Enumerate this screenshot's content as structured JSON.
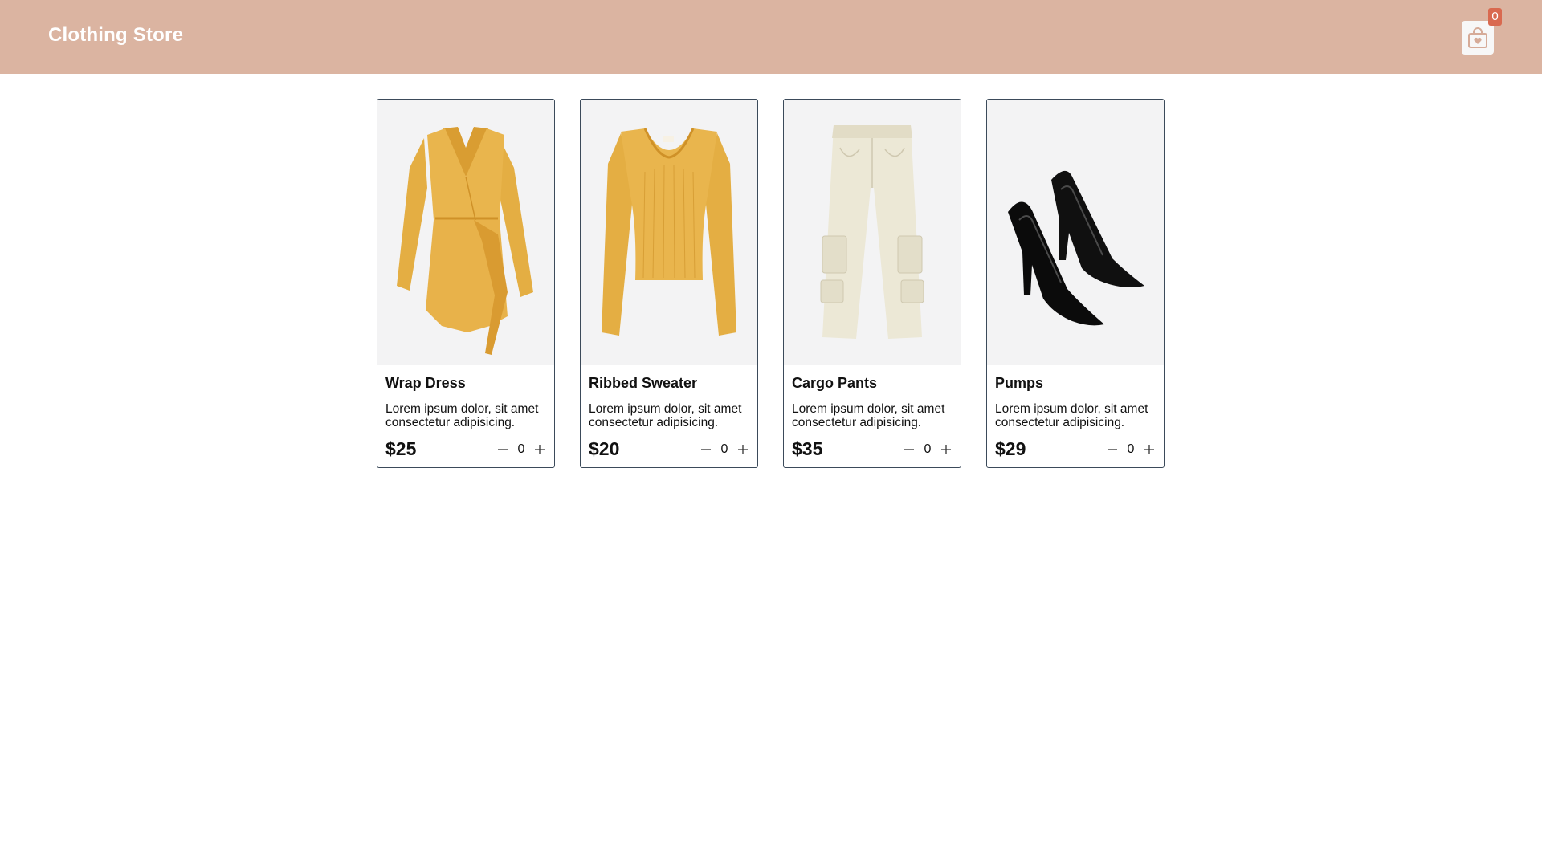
{
  "header": {
    "title": "Clothing Store",
    "cart_icon": "shopping-bag-icon",
    "cart_count": "0",
    "colors": {
      "bar": "#dbb4a1",
      "badge": "#d9694f"
    }
  },
  "products": [
    {
      "name": "Wrap Dress",
      "description": "Lorem ipsum dolor, sit amet consectetur adipisicing.",
      "price": "$25",
      "quantity": "0",
      "image": "yellow-wrap-dress"
    },
    {
      "name": "Ribbed Sweater",
      "description": "Lorem ipsum dolor, sit amet consectetur adipisicing.",
      "price": "$20",
      "quantity": "0",
      "image": "yellow-ribbed-sweater"
    },
    {
      "name": "Cargo Pants",
      "description": "Lorem ipsum dolor, sit amet consectetur adipisicing.",
      "price": "$35",
      "quantity": "0",
      "image": "cream-cargo-pants"
    },
    {
      "name": "Pumps",
      "description": "Lorem ipsum dolor, sit amet consectetur adipisicing.",
      "price": "$29",
      "quantity": "0",
      "image": "black-patent-pumps"
    }
  ],
  "stepper_icons": {
    "decrease": "minus-icon",
    "increase": "plus-icon"
  }
}
